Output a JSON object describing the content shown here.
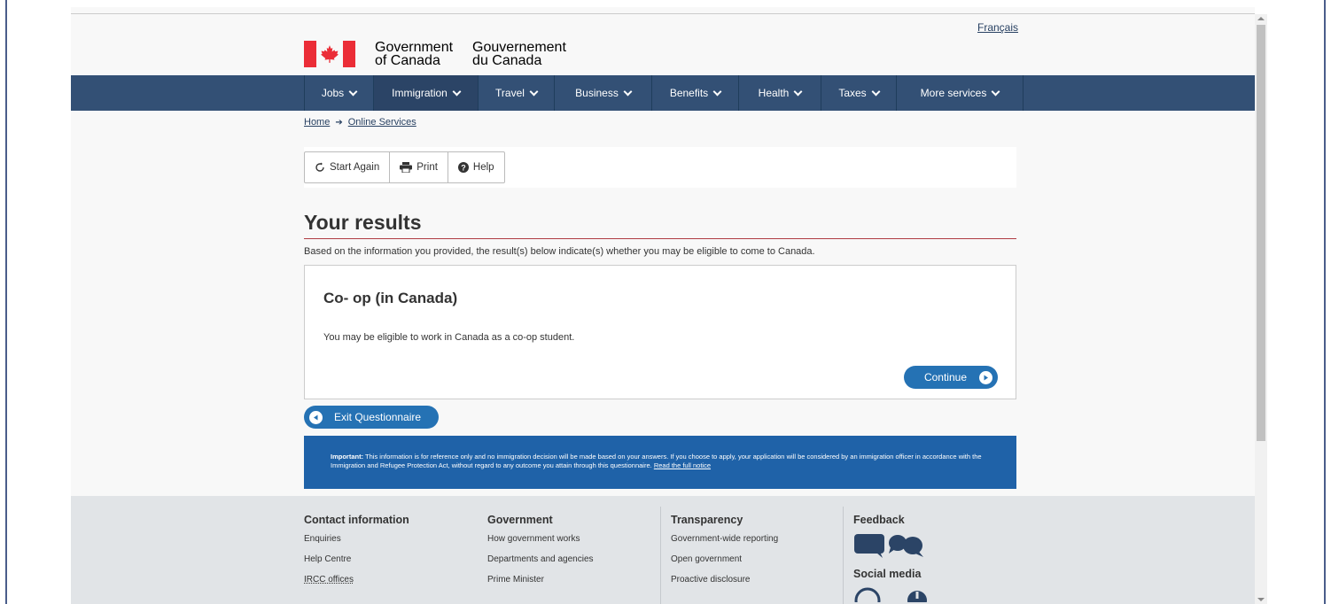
{
  "header": {
    "language_link": "Français",
    "signature_en_line1": "Government",
    "signature_en_line2": "of Canada",
    "signature_fr_line1": "Gouvernement",
    "signature_fr_line2": "du Canada",
    "flag_red": "#eb2d37"
  },
  "nav": {
    "items": [
      {
        "label": "Jobs",
        "width": 78
      },
      {
        "label": "Immigration",
        "width": 118,
        "active": true
      },
      {
        "label": "Travel",
        "width": 86
      },
      {
        "label": "Business",
        "width": 110
      },
      {
        "label": "Benefits",
        "width": 98
      },
      {
        "label": "Health",
        "width": 93
      },
      {
        "label": "Taxes",
        "width": 85
      },
      {
        "label": "More services",
        "width": 143
      }
    ],
    "color": "#335075"
  },
  "breadcrumb": {
    "home": "Home",
    "current": "Online Services"
  },
  "toolbar": {
    "start_again": "Start Again",
    "print": "Print",
    "help": "Help"
  },
  "main": {
    "title": "Your results",
    "intro": "Based on the information you provided, the result(s) below indicate(s) whether you may be eligible to come to Canada.",
    "result": {
      "title": "Co- op (in Canada)",
      "text": "You may be eligible to work in Canada as a co-op student.",
      "continue_label": "Continue"
    },
    "exit_label": "Exit Questionnaire"
  },
  "notice": {
    "important_label": "Important:",
    "text": " This information is for reference only and no immigration decision will be made based on your answers. If you choose to apply, your application will be considered by an immigration officer in accordance with the Immigration and Refugee Protection Act, without regard to any outcome you attain through this questionnaire. ",
    "link": "Read the full notice",
    "color": "#1f62a8"
  },
  "footer": {
    "contact": {
      "heading": "Contact information",
      "links": [
        "Enquiries",
        "Help Centre",
        "IRCC offices"
      ]
    },
    "government": {
      "heading": "Government",
      "links": [
        "How government works",
        "Departments and agencies",
        "Prime Minister"
      ]
    },
    "transparency": {
      "heading": "Transparency",
      "links": [
        "Government-wide reporting",
        "Open government",
        "Proactive disclosure"
      ]
    },
    "feedback": {
      "heading": "Feedback",
      "social_heading": "Social media"
    }
  }
}
